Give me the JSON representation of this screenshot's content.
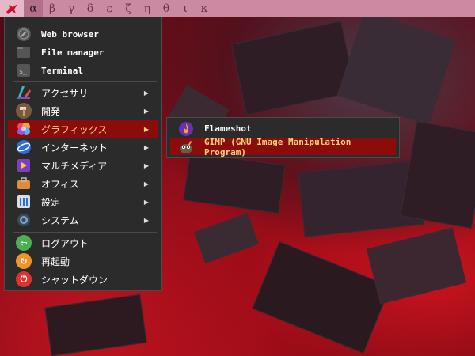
{
  "panel": {
    "workspaces": [
      "α",
      "β",
      "γ",
      "δ",
      "ε",
      "ζ",
      "η",
      "θ",
      "ι",
      "κ"
    ],
    "active_index": 0
  },
  "menu": {
    "favorites": [
      {
        "label": "Web browser",
        "icon": "globe-icon"
      },
      {
        "label": "File manager",
        "icon": "file-manager-icon"
      },
      {
        "label": "Terminal",
        "icon": "terminal-icon"
      }
    ],
    "categories": [
      {
        "label": "アクセサリ",
        "icon": "accessories-icon"
      },
      {
        "label": "開発",
        "icon": "hammer-icon"
      },
      {
        "label": "グラフィックス",
        "icon": "graphics-icon"
      },
      {
        "label": "インターネット",
        "icon": "internet-icon"
      },
      {
        "label": "マルチメディア",
        "icon": "multimedia-icon"
      },
      {
        "label": "オフィス",
        "icon": "briefcase-icon"
      },
      {
        "label": "設定",
        "icon": "settings-icon"
      },
      {
        "label": "システム",
        "icon": "gear-icon"
      }
    ],
    "arrow": "▶",
    "session": [
      {
        "label": "ログアウト",
        "icon": "logout-icon"
      },
      {
        "label": "再起動",
        "icon": "reboot-icon"
      },
      {
        "label": "シャットダウン",
        "icon": "power-icon"
      }
    ],
    "selected_category": "グラフィックス"
  },
  "submenu": {
    "items": [
      {
        "label": "Flameshot",
        "icon": "flameshot-icon"
      },
      {
        "label": "GIMP (GNU Image Manipulation Program)",
        "icon": "gimp-icon"
      }
    ],
    "selected": "GIMP (GNU Image Manipulation Program)"
  },
  "colors": {
    "panel_bg": "#cb8aa2",
    "menu_bg": "#2b2b2b",
    "selection_bg": "#8c0b0b",
    "selection_text": "#ffd27a"
  }
}
